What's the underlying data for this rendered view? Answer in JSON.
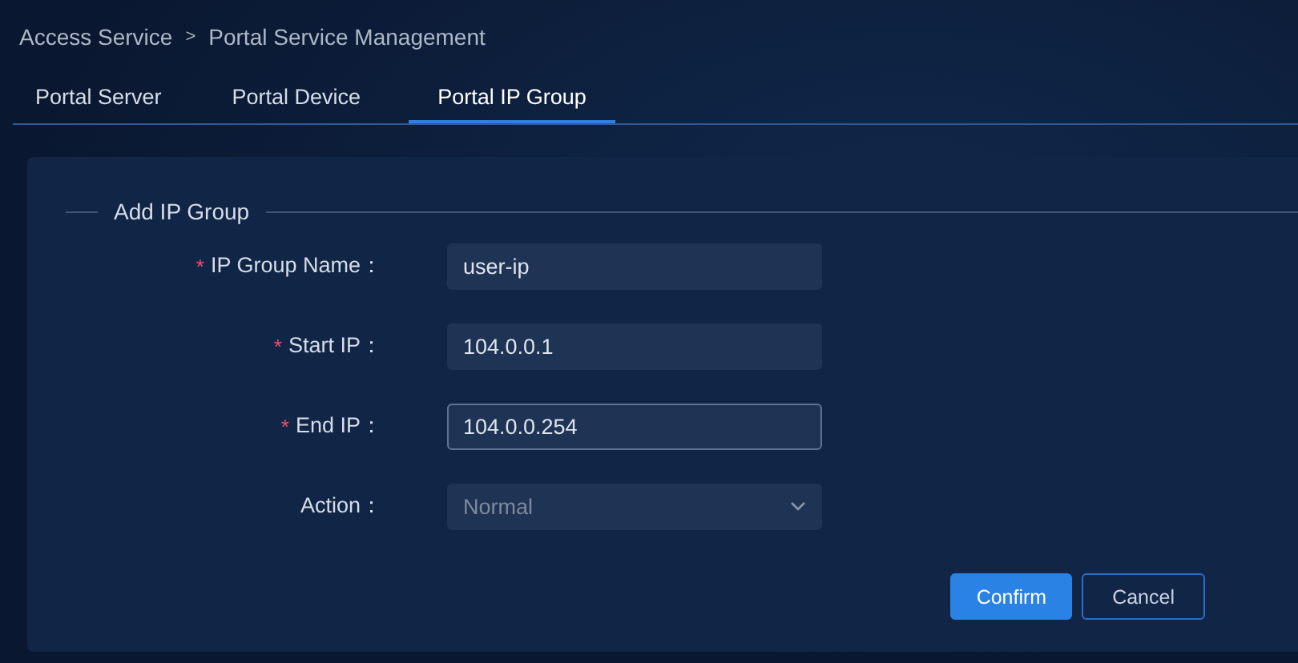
{
  "breadcrumb": {
    "items": [
      "Access Service",
      "Portal Service Management"
    ],
    "separator": ">"
  },
  "tabs": [
    {
      "label": "Portal Server",
      "selected": false
    },
    {
      "label": "Portal Device",
      "selected": false
    },
    {
      "label": "Portal IP Group",
      "selected": true
    }
  ],
  "form": {
    "title": "Add IP Group",
    "fields": [
      {
        "kind": "input",
        "required_mark": "*",
        "label": "IP Group Name：",
        "value": "user-ip",
        "focused": false
      },
      {
        "kind": "input",
        "required_mark": "*",
        "label": "Start IP：",
        "value": "104.0.0.1",
        "focused": false
      },
      {
        "kind": "input",
        "required_mark": "*",
        "label": "End IP：",
        "value": "104.0.0.254",
        "focused": true
      },
      {
        "kind": "select",
        "label": "Action：",
        "value": "Normal",
        "focused": false
      }
    ],
    "buttons": [
      {
        "label": "Confirm",
        "kind": "primary"
      },
      {
        "label": "Cancel",
        "kind": "secondary"
      }
    ]
  }
}
